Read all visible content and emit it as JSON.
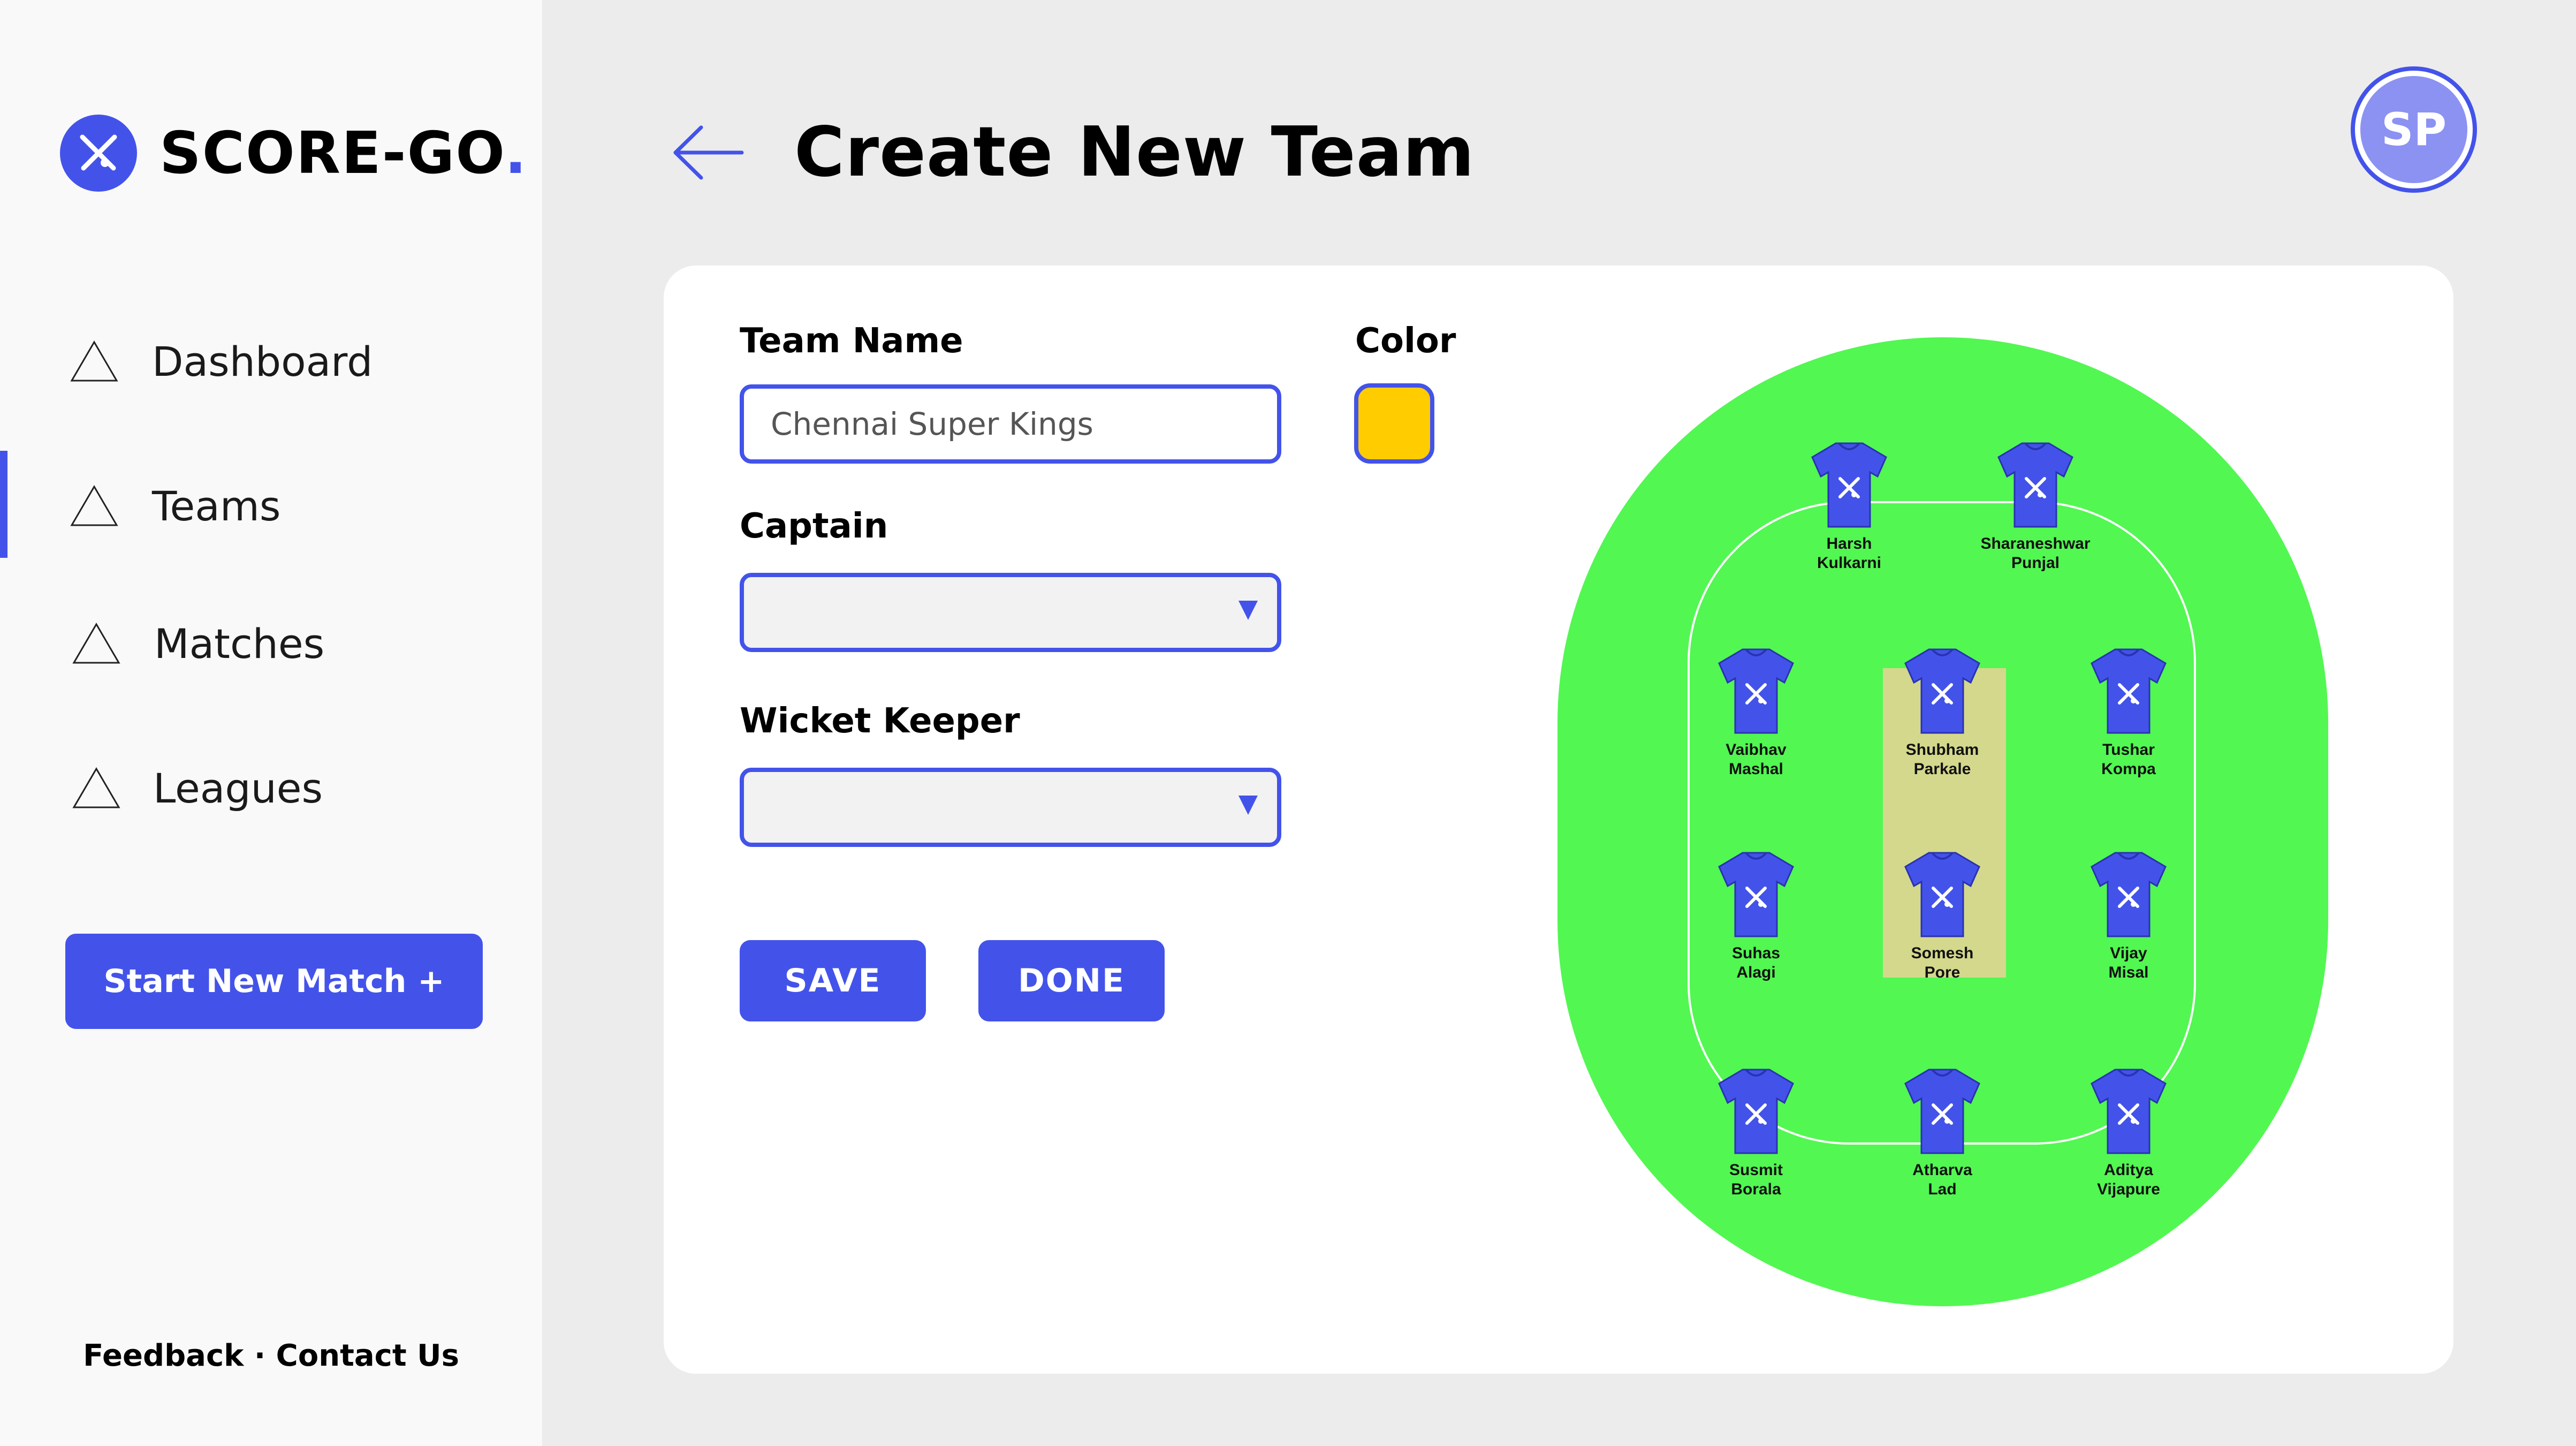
{
  "brand": {
    "name": "SCORE-GO",
    "dot": "."
  },
  "nav": {
    "items": [
      {
        "label": "Dashboard"
      },
      {
        "label": "Teams"
      },
      {
        "label": "Matches"
      },
      {
        "label": "Leagues"
      }
    ],
    "active": "Teams"
  },
  "sidebar": {
    "start_match_label": "Start New Match  +",
    "footer_feedback": "Feedback",
    "footer_sep": " · ",
    "footer_contact": "Contact Us"
  },
  "header": {
    "title": "Create New Team",
    "avatar_initials": "SP"
  },
  "form": {
    "team_name_label": "Team Name",
    "team_name_value": "Chennai Super Kings",
    "color_label": "Color",
    "color_value": "#ffcc00",
    "captain_label": "Captain",
    "captain_value": "",
    "wicket_keeper_label": "Wicket Keeper",
    "wicket_keeper_value": "",
    "save_label": "SAVE",
    "done_label": "DONE"
  },
  "colors": {
    "accent": "#4353ea",
    "field_green": "#52f752",
    "pitch": "#d4d88c",
    "jersey": "#4353ea"
  },
  "players": [
    {
      "first": "Harsh",
      "last": "Kulkarni"
    },
    {
      "first": "Sharaneshwar",
      "last": "Punjal"
    },
    {
      "first": "Vaibhav",
      "last": "Mashal"
    },
    {
      "first": "Shubham",
      "last": "Parkale"
    },
    {
      "first": "Tushar",
      "last": "Kompa"
    },
    {
      "first": "Suhas",
      "last": "Alagi"
    },
    {
      "first": "Somesh",
      "last": "Pore"
    },
    {
      "first": "Vijay",
      "last": "Misal"
    },
    {
      "first": "Susmit",
      "last": "Borala"
    },
    {
      "first": "Atharva",
      "last": "Lad"
    },
    {
      "first": "Aditya",
      "last": "Vijapure"
    }
  ]
}
